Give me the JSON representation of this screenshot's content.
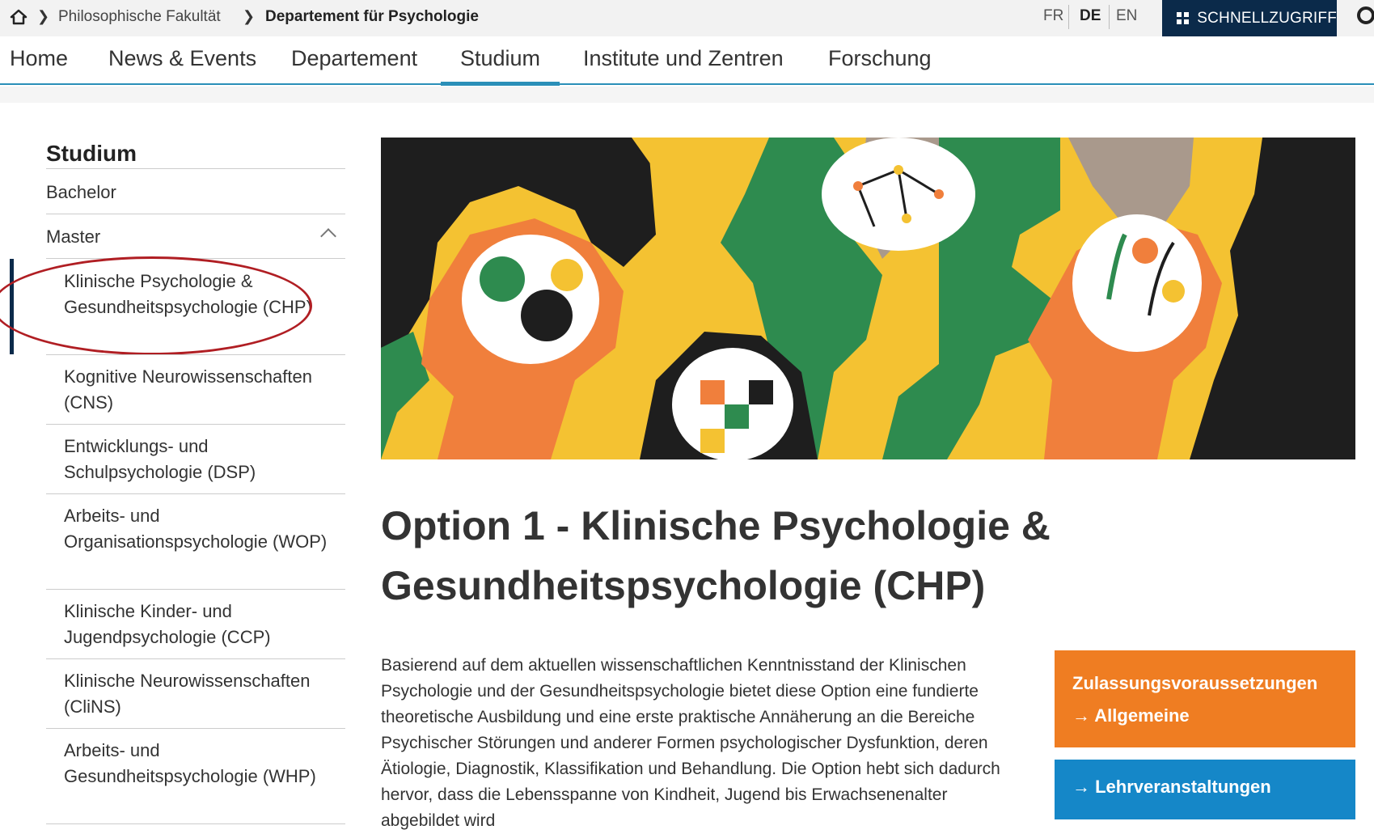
{
  "breadcrumb": {
    "items": [
      "Philosophische Fakultät",
      "Departement für Psychologie"
    ]
  },
  "languages": [
    "FR",
    "DE",
    "EN"
  ],
  "active_language": "DE",
  "quick_access_label": "SCHNELLZUGRIFF",
  "nav": {
    "items": [
      "Home",
      "News & Events",
      "Departement",
      "Studium",
      "Institute und Zentren",
      "Forschung"
    ],
    "active": "Studium"
  },
  "sidebar": {
    "title": "Studium",
    "items": [
      "Bachelor",
      "Master"
    ],
    "sub_items": [
      "Klinische Psychologie & Gesundheitspsychologie (CHP)",
      "Kognitive Neurowissenschaften (CNS)",
      "Entwicklungs- und Schulpsychologie (DSP)",
      "Arbeits- und Organisationspsychologie (WOP)",
      "Klinische Kinder- und Jugendpsychologie (CCP)",
      "Klinische Neurowissenschaften (CliNS)",
      "Arbeits- und Gesundheitspsychologie (WHP)"
    ],
    "active_sub_item": "Klinische Psychologie & Gesundheitspsychologie (CHP)"
  },
  "main": {
    "title": "Option 1 - Klinische Psychologie & Gesundheitspsychologie (CHP)",
    "body": "Basierend auf dem aktuellen wissenschaftlichen Kenntnisstand der Klinischen Psychologie und der Gesundheitspsychologie bietet diese Option eine fundierte theoretische Ausbildung und eine erste praktische Annäherung an die Bereiche Psychischer Störungen und anderer Formen psychologischer Dysfunktion, deren Ätiologie, Diagnostik, Klassifikation und Behandlung. Die Option hebt sich dadurch hervor, dass die Lebensspanne von Kindheit, Jugend bis Erwachsenenalter abgebildet wird"
  },
  "aside": {
    "admission_title": "Zulassungsvoraussetzungen",
    "admission_link": "→ Allgemeine",
    "courses_link": "→ Lehrveranstaltungen"
  },
  "colors": {
    "navy": "#0b2a4a",
    "accent_blue": "#2a8fb8",
    "orange": "#ef7d22",
    "button_blue": "#1587c8",
    "highlight_red": "#b01e23"
  }
}
